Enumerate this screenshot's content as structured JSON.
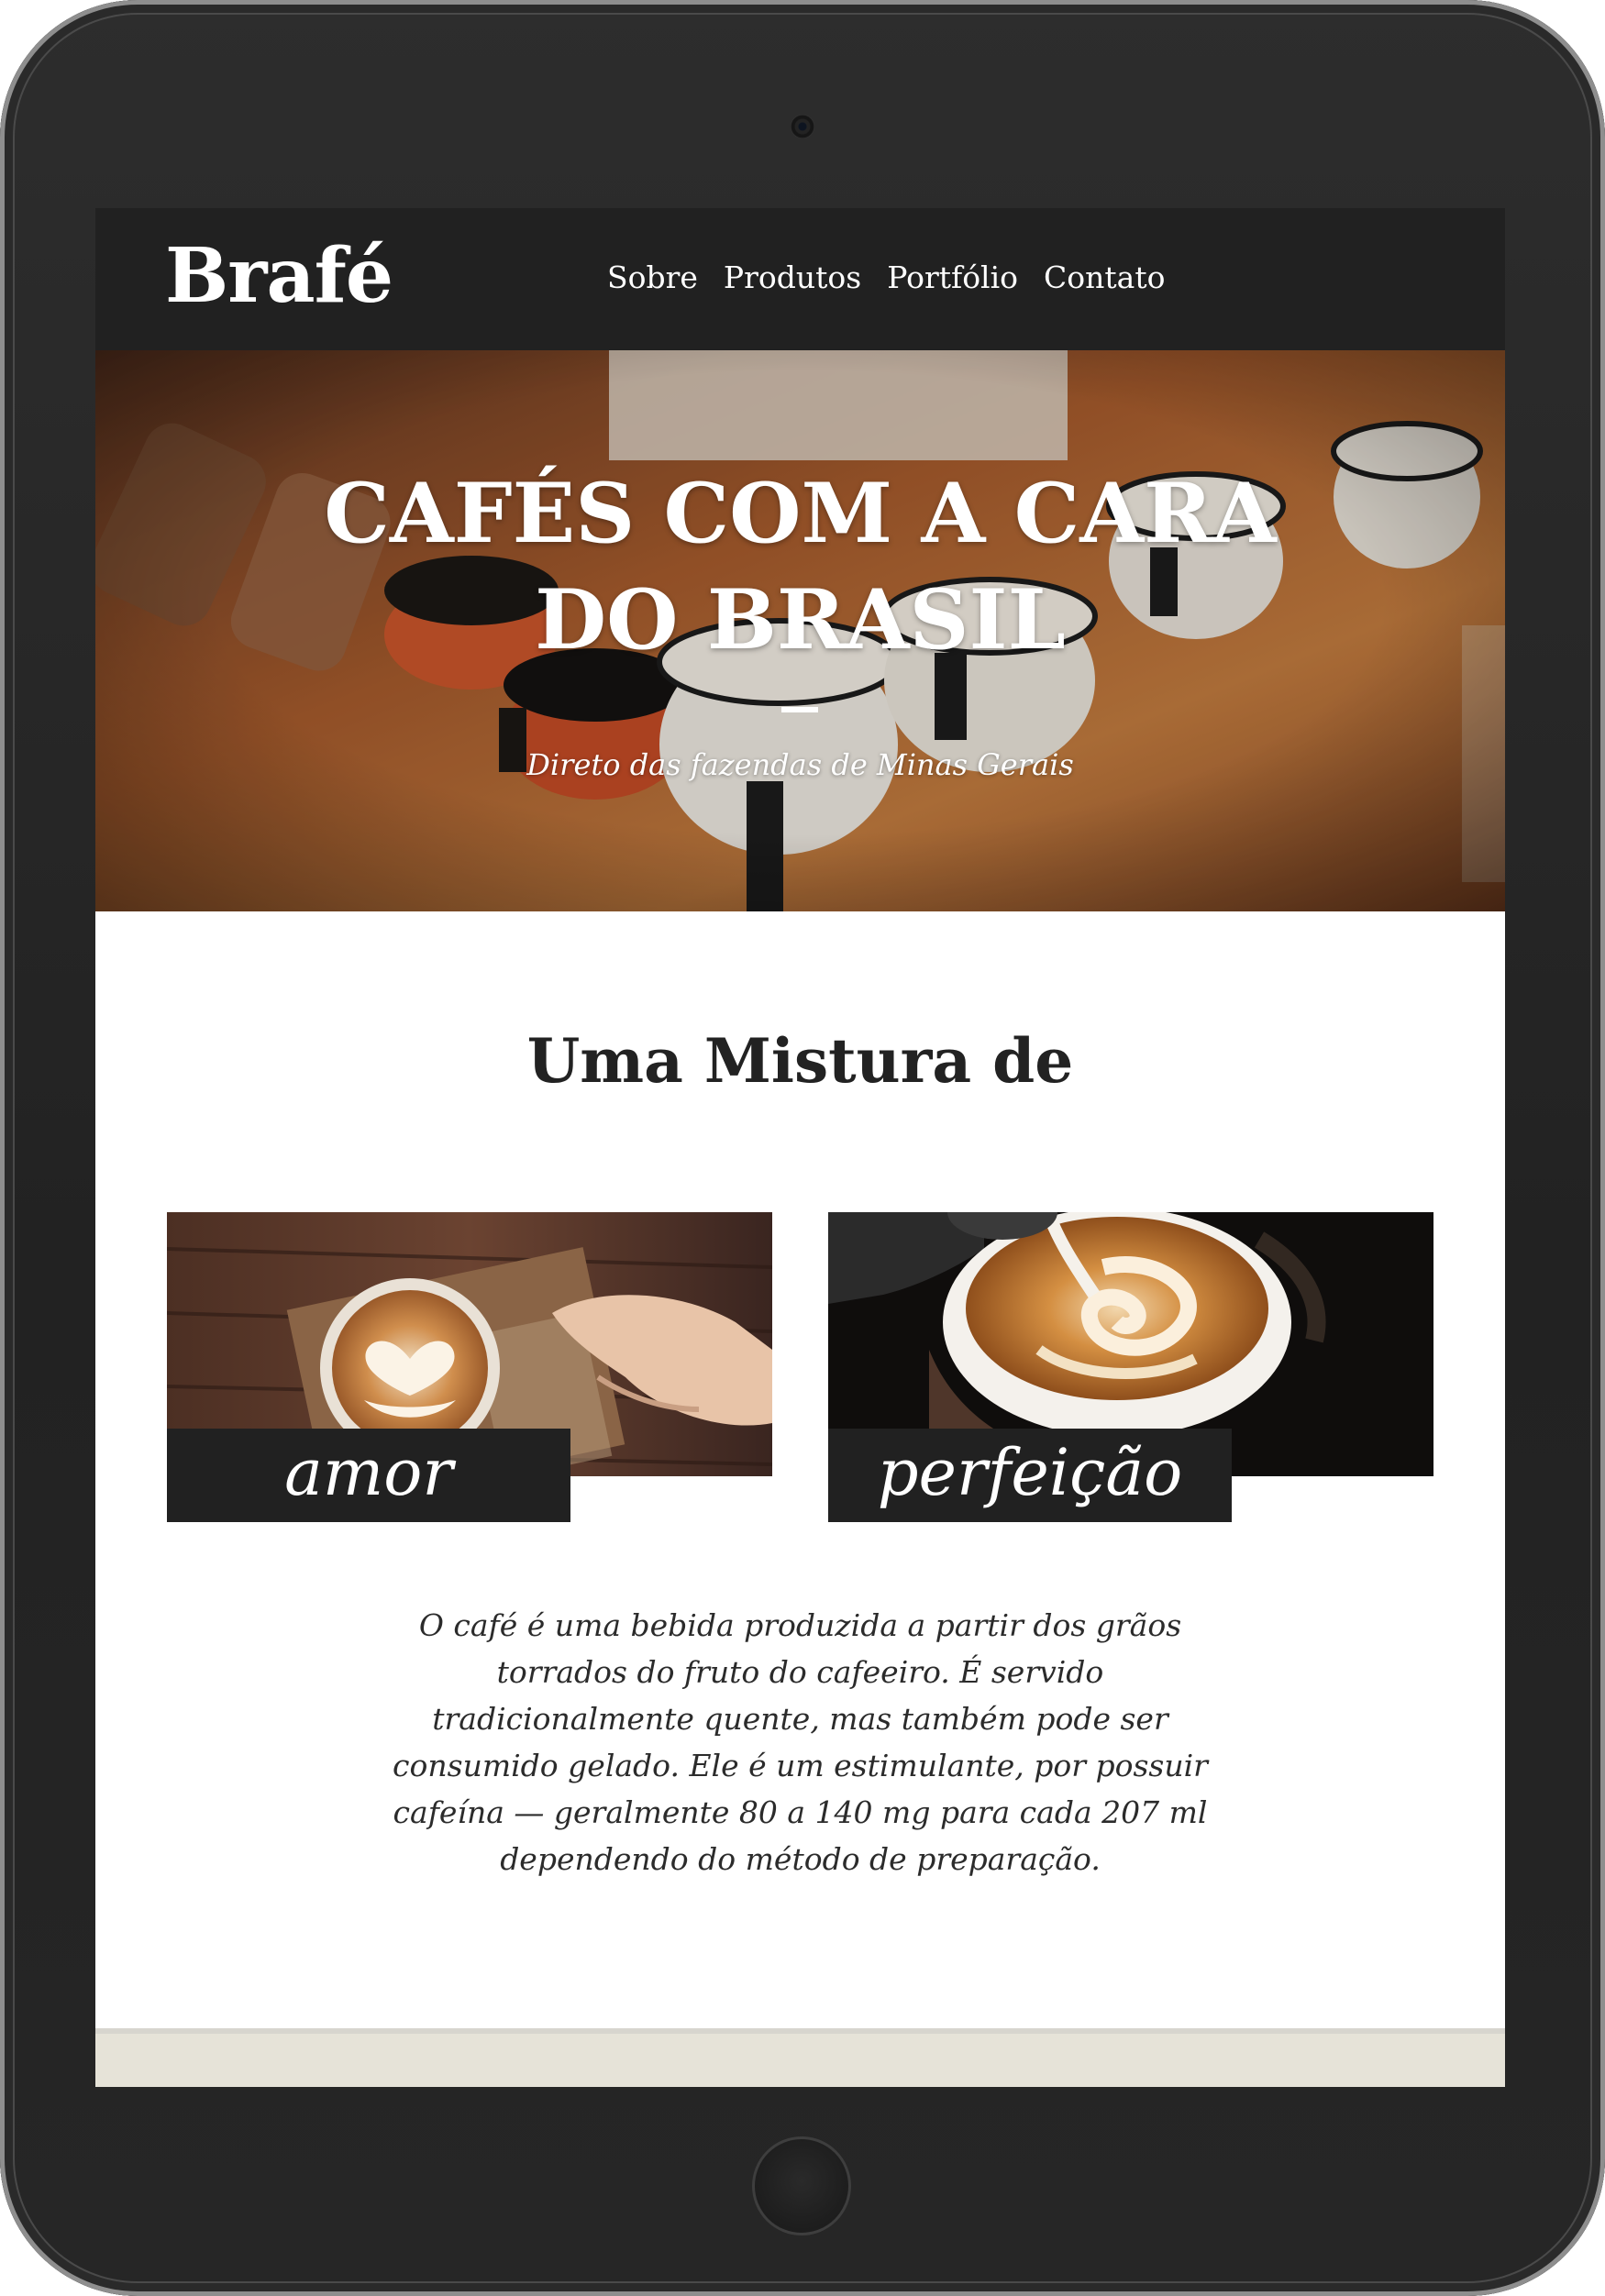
{
  "header": {
    "logo": "Brafé",
    "nav": [
      "Sobre",
      "Produtos",
      "Portfólio",
      "Contato"
    ]
  },
  "hero": {
    "title_line1": "Cafés com a cara",
    "title_line2": "do Brasil",
    "subtitle": "Direto das fazendas de Minas Gerais"
  },
  "section": {
    "title": "Uma Mistura de",
    "cards": [
      {
        "label": "amor",
        "image": "latte-art-heart-photo"
      },
      {
        "label": "perfeição",
        "image": "milk-pour-cappuccino-photo"
      }
    ],
    "description": "O café é uma bebida produzida a partir dos grãos torrados do fruto do cafeeiro. É servido tradicionalmente quente, mas também pode ser consumido gelado. Ele é um estimulante, por possuir cafeína — geralmente 80 a 140 mg para cada 207 ml dependendo do método de preparação."
  },
  "colors": {
    "dark": "#212121",
    "footer_band": "#e6e3d8",
    "text": "#2b2b2b"
  }
}
